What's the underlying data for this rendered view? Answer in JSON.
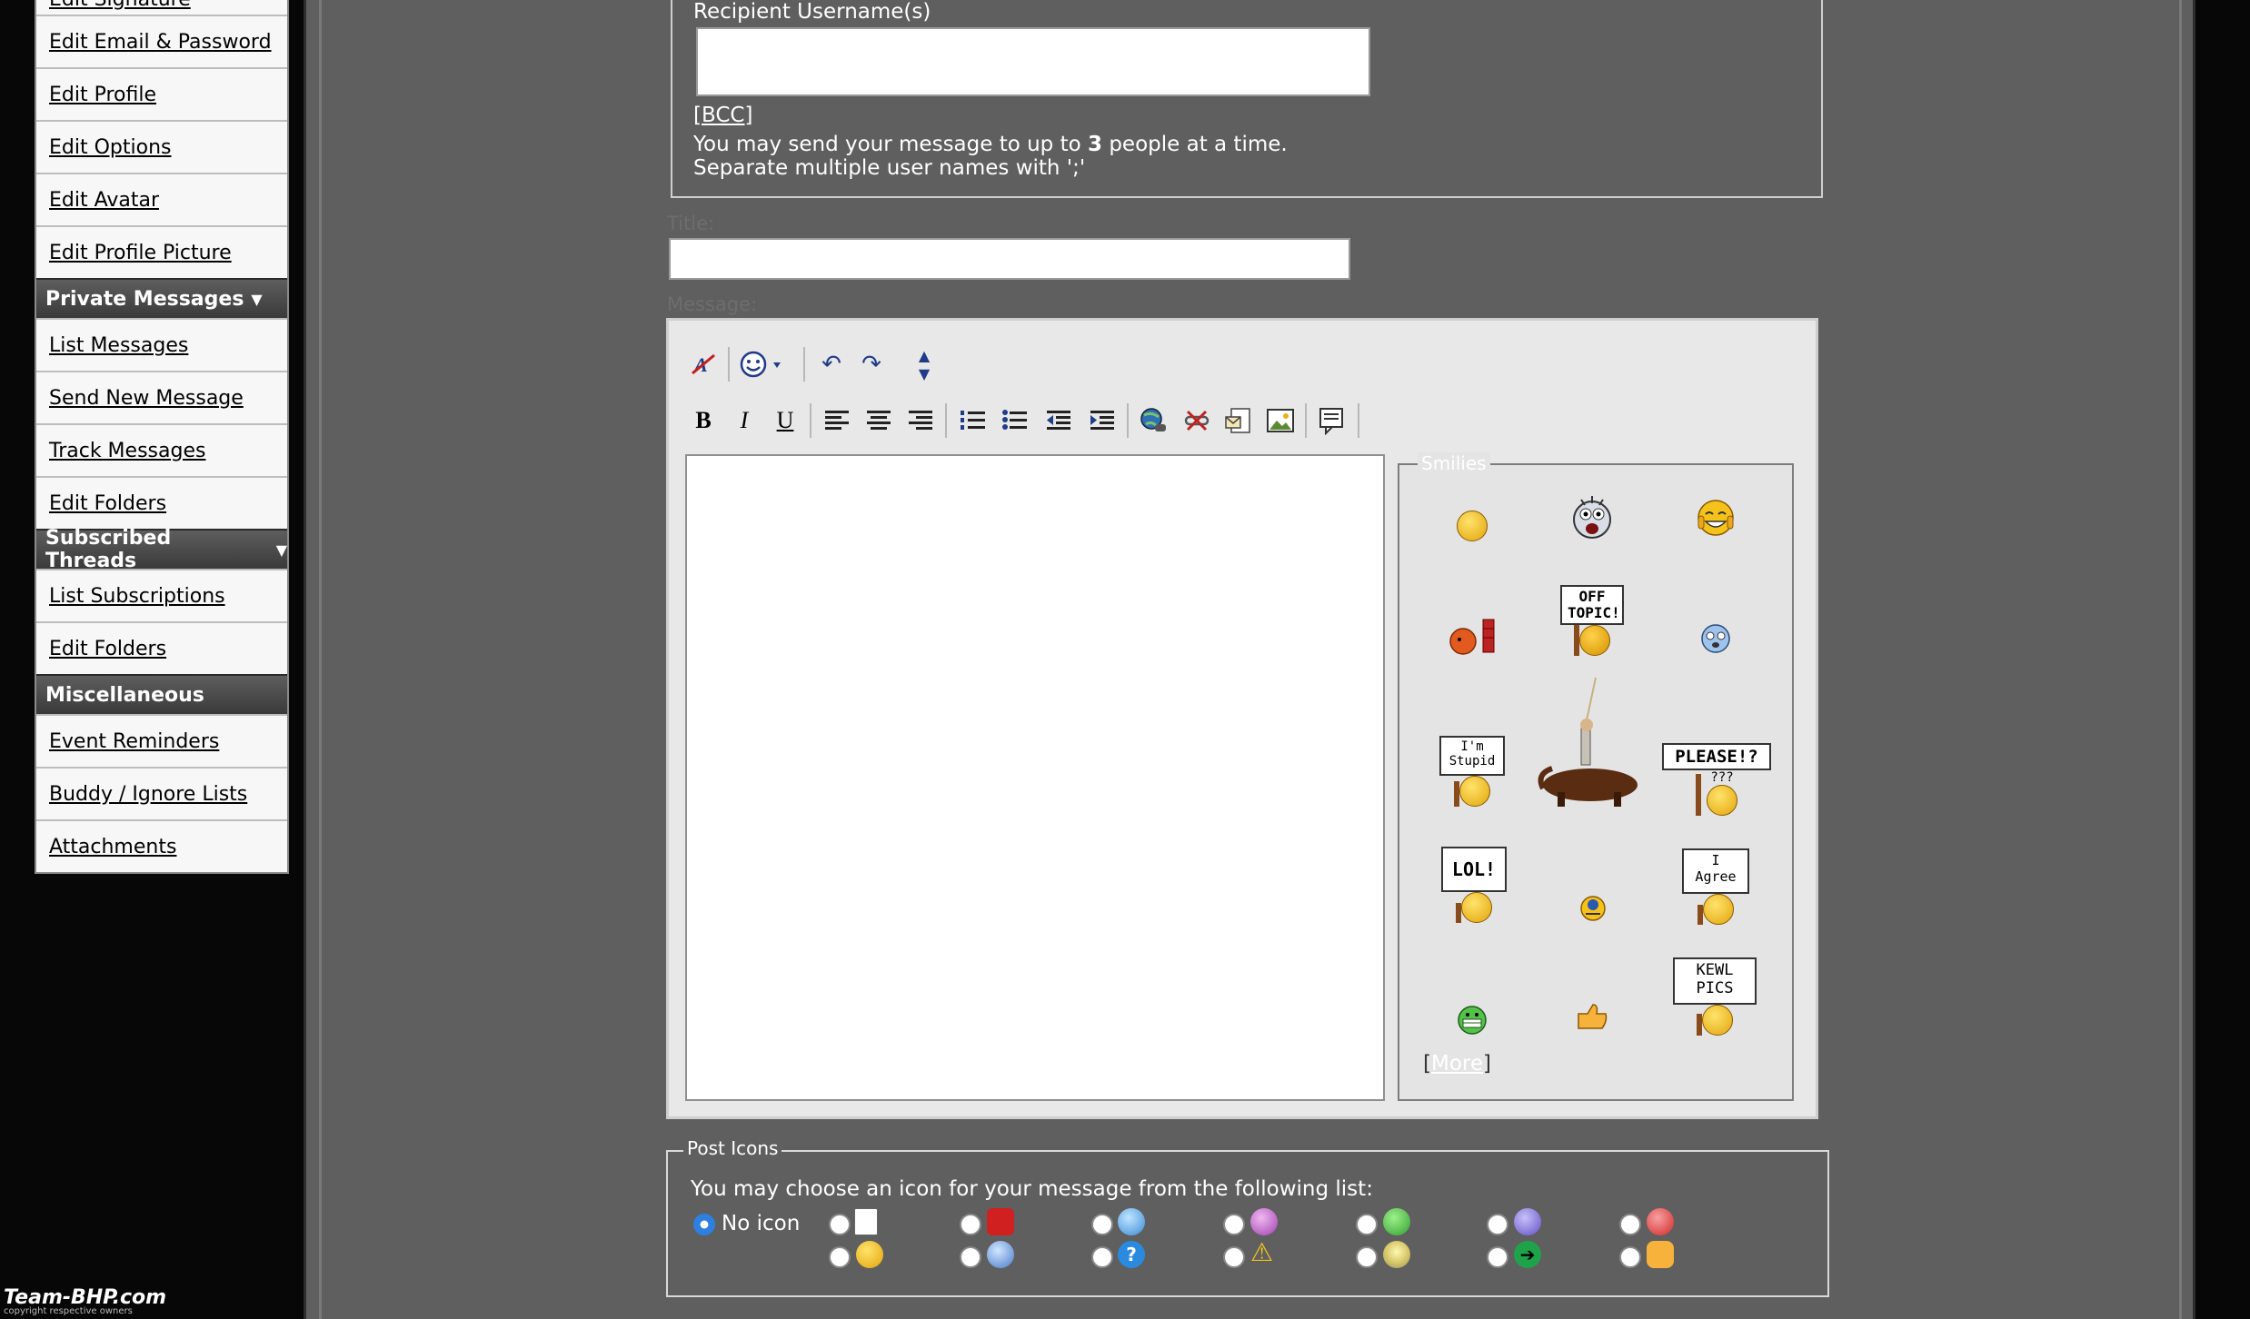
{
  "sidebar": {
    "sections": [
      {
        "links": [
          "Edit Signature",
          "Edit Email & Password",
          "Edit Profile",
          "Edit Options",
          "Edit Avatar",
          "Edit Profile Picture"
        ]
      },
      {
        "title": "Private Messages",
        "links": [
          "List Messages",
          "Send New Message",
          "Track Messages",
          "Edit Folders"
        ]
      },
      {
        "title": "Subscribed Threads",
        "links": [
          "List Subscriptions",
          "Edit Folders"
        ]
      },
      {
        "title": "Miscellaneous",
        "links": [
          "Event Reminders",
          "Buddy / Ignore Lists",
          "Attachments"
        ]
      }
    ]
  },
  "recipients": {
    "label": "Recipient Username(s)",
    "bcc_link": "[BCC]",
    "hint_prefix": "You may send your message to up to",
    "hint_count": "3",
    "hint_suffix": "people at a time.",
    "hint_line2": "Separate multiple user names with ';'"
  },
  "title_field": {
    "label": "Title:",
    "value": ""
  },
  "message_field": {
    "label": "Message:",
    "value": ""
  },
  "toolbar": {
    "buttons": [
      "remove-format",
      "smilies",
      "undo",
      "redo",
      "resize",
      "bold",
      "italic",
      "underline",
      "align-left",
      "align-center",
      "align-right",
      "ordered-list",
      "unordered-list",
      "outdent",
      "indent",
      "insert-link",
      "remove-link",
      "insert-email",
      "insert-image",
      "quote"
    ],
    "bold": "B",
    "italic": "I",
    "underline": "U"
  },
  "smilies": {
    "legend": "Smilies",
    "more_link": "More",
    "more_open": "[",
    "more_close": "]",
    "signs": {
      "offtopic": "OFF TOPIC!",
      "stupid": "I'm Stupid",
      "please": "PLEASE!?",
      "please_q": "???",
      "lol": "LOL!",
      "agree": "I Agree",
      "kewl": "KEWL PICS"
    }
  },
  "post_icons": {
    "legend": "Post Icons",
    "prompt": "You may choose an icon for your message from the following list:",
    "no_icon_label": "No icon",
    "selected": "No icon"
  },
  "footer": {
    "logo": "Team-BHP.com",
    "sub": "copyright respective owners"
  },
  "colors": {
    "page_bg": "#5f5f5f",
    "sidebar_header": "#4a4a4a",
    "accent_blue": "#2d7fe0"
  }
}
